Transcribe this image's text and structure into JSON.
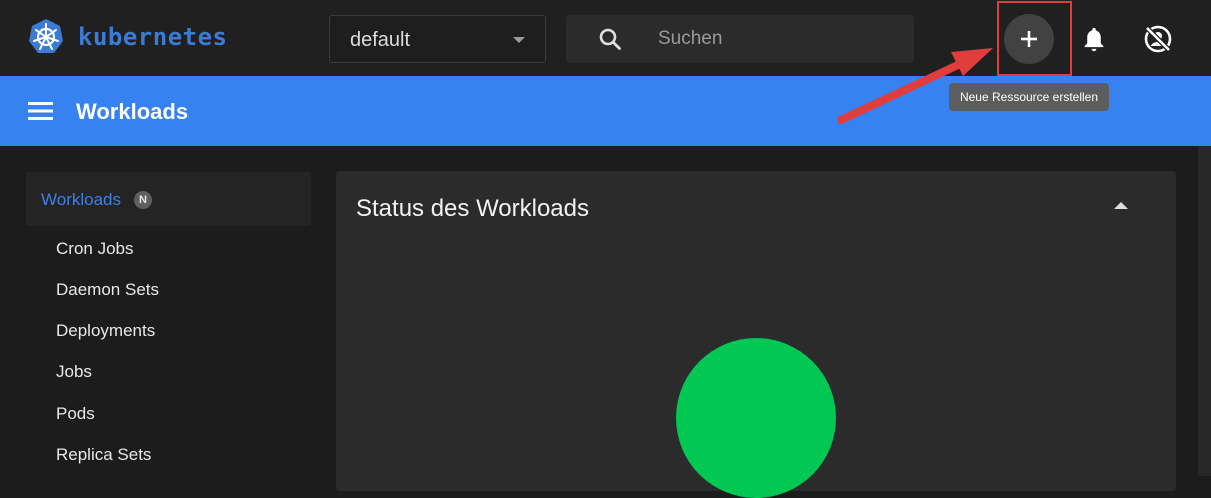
{
  "app": {
    "name": "kubernetes",
    "brand_color": "#3a7bd5"
  },
  "header": {
    "namespace_selected": "default",
    "search_placeholder": "Suchen",
    "create_button_icon": "plus-icon",
    "notifications_icon": "bell-icon",
    "user_icon": "user-crossed-icon"
  },
  "toolbar": {
    "title": "Workloads",
    "menu_icon": "hamburger-icon"
  },
  "tooltip": {
    "text": "Neue Ressource erstellen"
  },
  "sidebar": {
    "header_label": "Workloads",
    "header_badge": "N",
    "items": [
      {
        "label": "Cron Jobs"
      },
      {
        "label": "Daemon Sets"
      },
      {
        "label": "Deployments"
      },
      {
        "label": "Jobs"
      },
      {
        "label": "Pods"
      },
      {
        "label": "Replica Sets"
      }
    ]
  },
  "card": {
    "title": "Status des Workloads",
    "status_color": "#00c853"
  },
  "colors": {
    "primary": "#3582f0",
    "annotation": "#e23d3d"
  }
}
